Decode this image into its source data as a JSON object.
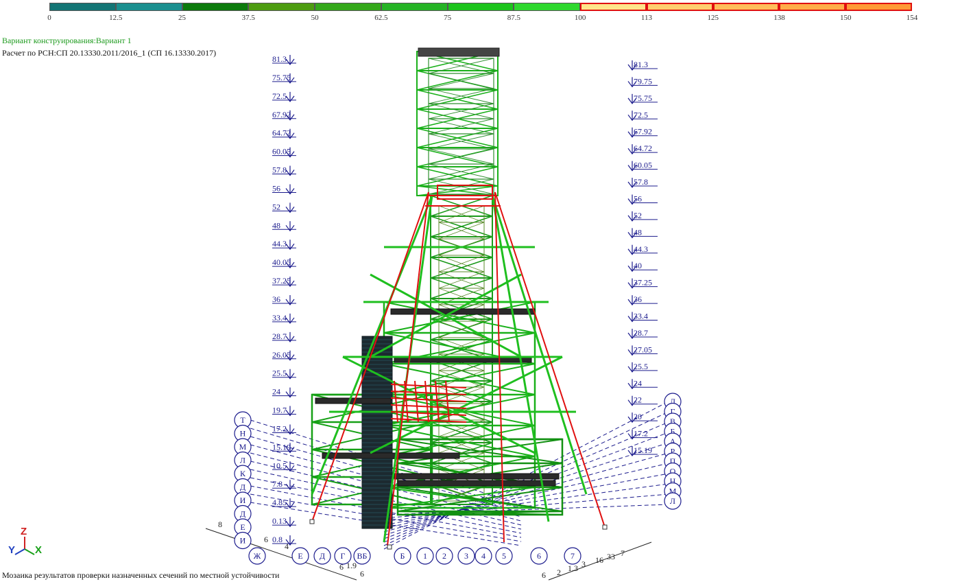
{
  "scale": {
    "segments": [
      {
        "color": "#137575",
        "status": "ok"
      },
      {
        "color": "#1a8f8f",
        "status": "ok"
      },
      {
        "color": "#0c7a0c",
        "status": "ok"
      },
      {
        "color": "#4d9c10",
        "status": "ok"
      },
      {
        "color": "#34a81a",
        "status": "ok"
      },
      {
        "color": "#25b325",
        "status": "ok"
      },
      {
        "color": "#1cc41c",
        "status": "ok"
      },
      {
        "color": "#2ed82e",
        "status": "ok"
      },
      {
        "color": "#ffe58a",
        "status": "over"
      },
      {
        "color": "#ffcf70",
        "status": "over"
      },
      {
        "color": "#ffbe5a",
        "status": "over"
      },
      {
        "color": "#ffad48",
        "status": "over"
      },
      {
        "color": "#ff9a36",
        "status": "over"
      }
    ],
    "ticks": [
      "0",
      "12.5",
      "25",
      "37.5",
      "50",
      "62.5",
      "75",
      "87.5",
      "100",
      "113",
      "125",
      "138",
      "150",
      "154"
    ]
  },
  "info": {
    "variant": "Вариант конструирования:Вариант 1",
    "norm": "Расчет по РСН:СП 20.13330.2011/2016_1 (СП 16.13330.2017)"
  },
  "footer": "Мозаика результатов проверки назначенных сечений по местной устойчивости",
  "levels_left": [
    "81.3",
    "75.75",
    "72.5",
    "67.92",
    "64.72",
    "60.05",
    "57.8",
    "56",
    "52",
    "48",
    "44.3",
    "40.05",
    "37.25",
    "36",
    "33.4",
    "28.7",
    "26.05",
    "25.5",
    "24",
    "19.7",
    "17.2",
    "15.19",
    "10.5",
    "7.8",
    "4.85",
    "0.13",
    "0.8"
  ],
  "levels_right": [
    "81.3",
    "79.75",
    "75.75",
    "72.5",
    "67.92",
    "64.72",
    "60.05",
    "57.8",
    "56",
    "52",
    "48",
    "44.3",
    "40",
    "37.25",
    "36",
    "33.4",
    "28.7",
    "27.05",
    "25.5",
    "24",
    "22",
    "20",
    "17.2",
    "15.19"
  ],
  "axes_left_circles": [
    "Т",
    "Н",
    "М",
    "Л",
    "К",
    "Д",
    "И",
    "Д",
    "Е",
    "И"
  ],
  "axes_bottom": [
    "Ж",
    "Е",
    "Д",
    "Г",
    "ВБ",
    "Б",
    "1",
    "2",
    "3",
    "4",
    "5",
    "6",
    "7"
  ],
  "axes_right_circles": [
    "Д",
    "Г",
    "В",
    "Б",
    "А",
    "Р",
    "П",
    "О",
    "Н",
    "М",
    "Л"
  ],
  "dims": [
    "8",
    "6",
    "4",
    "6",
    "1.9",
    "6",
    "6",
    "2",
    "1.3",
    "3",
    "16",
    "33",
    "7"
  ],
  "triad": {
    "z": "Z",
    "y": "Y",
    "x": "X"
  },
  "colors": {
    "ok": "#1fbf1f",
    "over": "#e01010",
    "dim": "#1a1a8c"
  }
}
